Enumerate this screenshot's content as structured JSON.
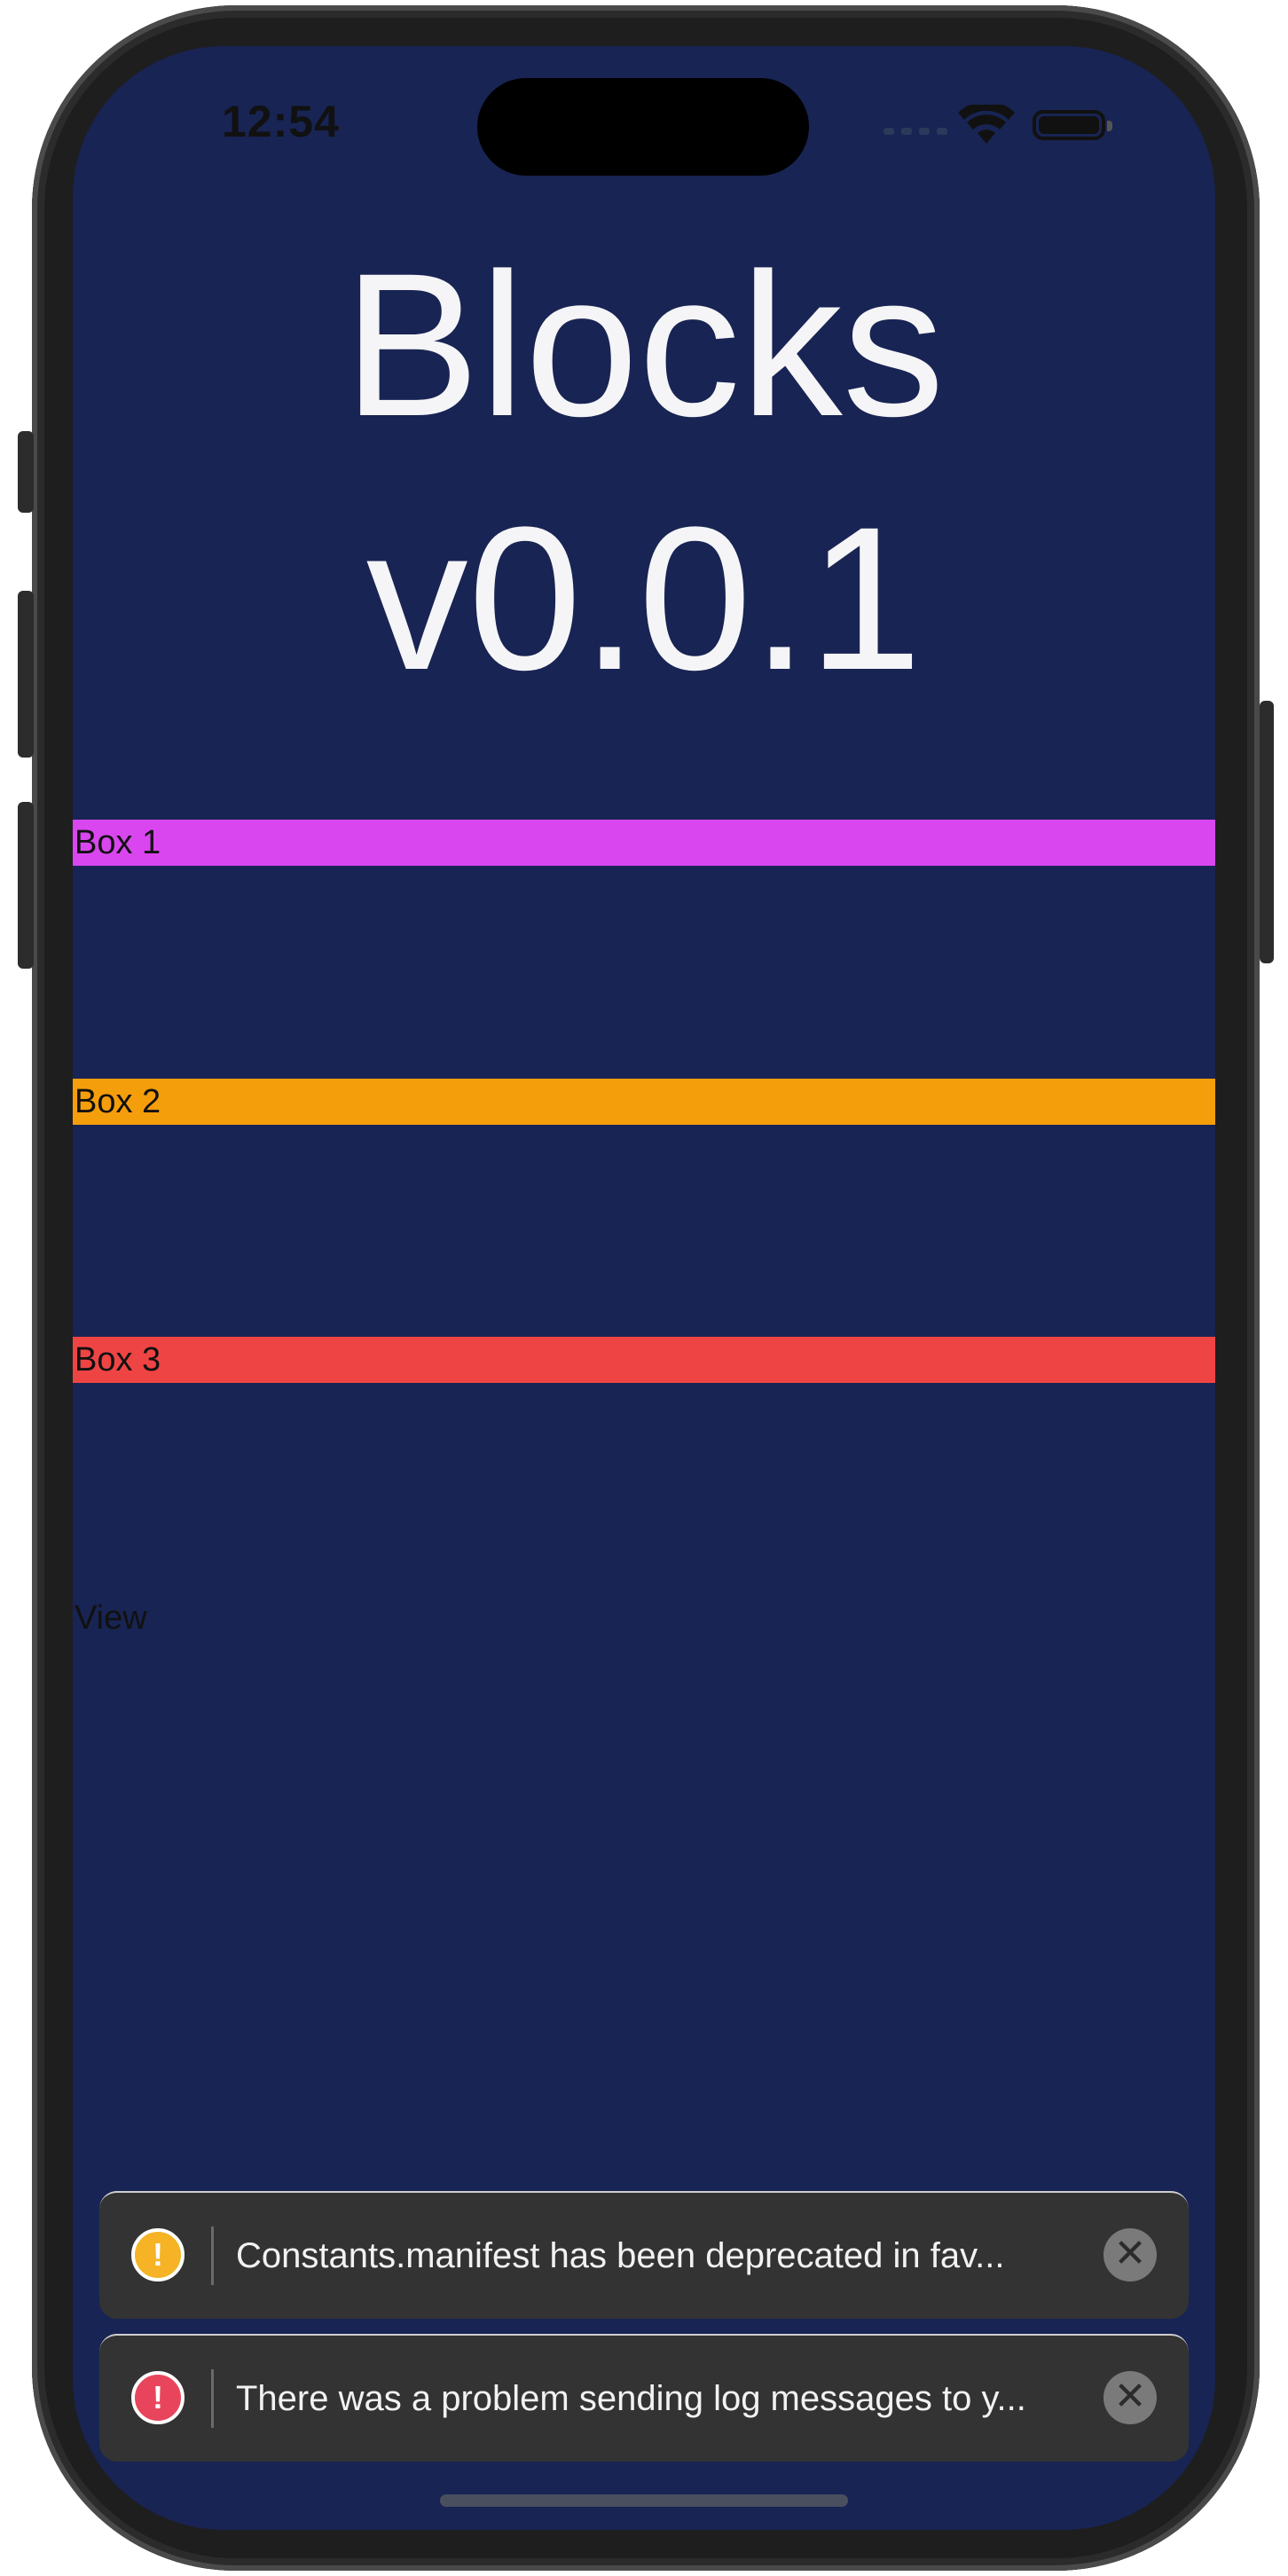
{
  "status_bar": {
    "time": "12:54"
  },
  "title": {
    "line1": "Blocks",
    "line2": "v0.0.1"
  },
  "boxes": [
    {
      "label": "Box 1",
      "color": "#d946ef"
    },
    {
      "label": "Box 2",
      "color": "#f59e0b"
    },
    {
      "label": "Box 3",
      "color": "#ef4444"
    }
  ],
  "view_label": "View",
  "toasts": [
    {
      "type": "warning",
      "icon": "!",
      "text": "Constants.manifest has been deprecated in fav...",
      "close": "✕"
    },
    {
      "type": "error",
      "icon": "!",
      "text": "There was a problem sending log messages to y...",
      "close": "✕"
    }
  ],
  "colors": {
    "background": "#182453",
    "title": "#f5f5f7",
    "toast_bg": "#333333"
  }
}
